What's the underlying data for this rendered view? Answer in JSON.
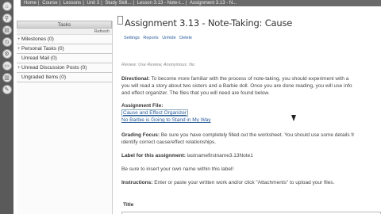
{
  "breadcrumb": [
    "Home",
    "Course",
    "Lessons",
    "Unit 3",
    "Study Skill...",
    "Lesson 3.13 - Note-t...",
    "Assignment 3.13 - N..."
  ],
  "breadcrumb_sep": "|",
  "sidebar": {
    "header": "Tasks",
    "refresh": "Refresh",
    "items": [
      {
        "label": "Milestones (0)",
        "expandable": "+"
      },
      {
        "label": "Personal Tasks (0)",
        "expandable": "+"
      },
      {
        "label": "Unread Mail (0)",
        "expandable": ""
      },
      {
        "label": "Unread Discussion Posts (0)",
        "expandable": "+"
      },
      {
        "label": "Ungraded Items (0)",
        "expandable": ""
      }
    ]
  },
  "rail_icons": [
    "home-icon",
    "search-icon",
    "book-icon",
    "clock-icon",
    "gear-icon",
    "folder-icon",
    "chart-icon",
    "tools-icon"
  ],
  "main": {
    "title": "Assignment 3.13 - Note-Taking: Cause",
    "actions": [
      "Settings",
      "Reports",
      "Unhide",
      "Delete"
    ],
    "review": "Review: Use Review, Anonymous: No",
    "directional_label": "Directional:",
    "directional_text": "To become more familiar with the process of note-taking, you should experiment with a",
    "directional_text2": "you will read a story about two sisters and a Barbie doll.  Once you are done reading, you will use info",
    "directional_text3": "and effect organizer.  The files that you will need are found below.",
    "file_label": "Assignment File:",
    "file_links": [
      "Cause and Effect Organizer",
      "No Barbie is Going to Stand in My Way"
    ],
    "grading_label": "Grading Focus:",
    "grading_text": "Be sure you have completely filled out the worksheet.  You should use some details fr",
    "grading_text2": "identify correct cause/effect relationships.",
    "assign_label": "Label for this assignment:",
    "assign_value": "lastnamefirstname3.13Note1",
    "reminder": "Be sure to insert your own name within this label!",
    "instructions_label": "Instructions:",
    "instructions_text": "Enter or paste your written work and/or click \"Attachments\" to upload your files.",
    "title_field_label": "Title",
    "title_field_value": ""
  }
}
